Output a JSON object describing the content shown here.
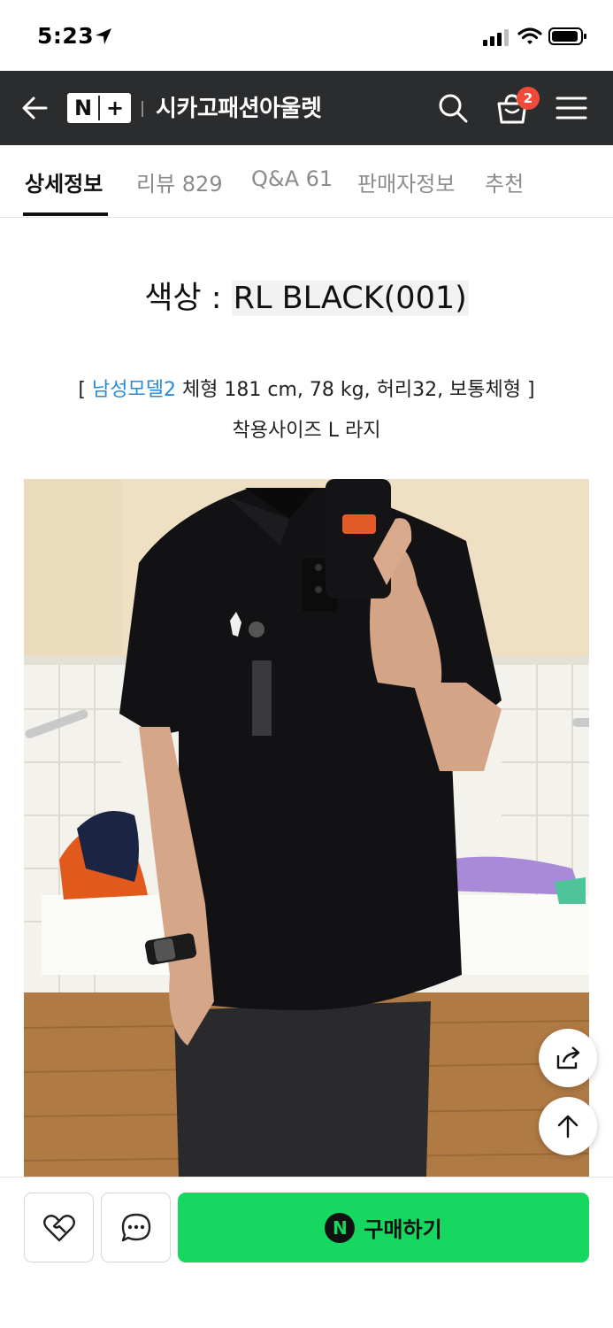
{
  "status_bar": {
    "time": "5:23"
  },
  "header": {
    "logo_n": "N",
    "logo_plus": "+",
    "store_name": "시카고패션아울렛",
    "cart_count": "2",
    "colors": {
      "background": "#2b2c2e",
      "badge": "#f04a3b"
    }
  },
  "tabs": [
    {
      "label": "상세정보",
      "active": true
    },
    {
      "label": "리뷰 829",
      "active": false
    },
    {
      "label": "Q&A 61",
      "active": false
    },
    {
      "label": "판매자정보",
      "active": false
    },
    {
      "label": "추천",
      "active": false
    }
  ],
  "detail": {
    "color_label": "색상 : ",
    "color_value": "RL BLACK(001)",
    "model_open": "[ ",
    "model_name": "남성모델2",
    "model_body": " 체형 181 cm, 78 kg, 허리32, 보통체형 ]",
    "size_worn": "착용사이즈 L 라지"
  },
  "bottom_bar": {
    "buy_label": "구매하기",
    "npay_mark": "N",
    "buy_color": "#16d860"
  }
}
